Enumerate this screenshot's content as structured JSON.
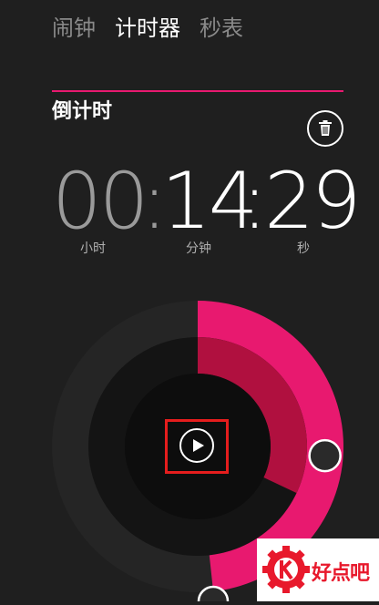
{
  "tabs": [
    {
      "label": "闹钟",
      "active": false
    },
    {
      "label": "计时器",
      "active": true
    },
    {
      "label": "秒表",
      "active": false
    }
  ],
  "section_title": "倒计时",
  "timer": {
    "hours": "00",
    "minutes": "14",
    "seconds": "29",
    "separator": ":",
    "unit_hours": "小时",
    "unit_minutes": "分钟",
    "unit_seconds": "秒",
    "outer_ring_fraction": 0.483,
    "inner_ring_fraction": 0.32
  },
  "icons": {
    "delete": "trash-icon",
    "play": "play-icon"
  },
  "watermark": {
    "text": "好点吧"
  },
  "colors": {
    "accent": "#e8196f",
    "inner_ring": "#b0103f",
    "background": "#1f1f1f",
    "highlight_frame": "#e51d1d"
  }
}
